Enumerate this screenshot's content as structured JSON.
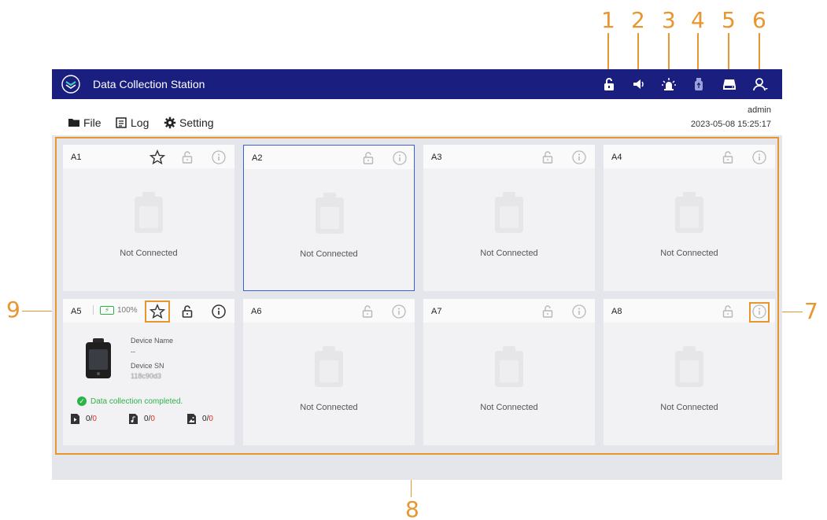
{
  "callouts": [
    "1",
    "2",
    "3",
    "4",
    "5",
    "6",
    "7",
    "8",
    "9"
  ],
  "app": {
    "title": "Data Collection Station",
    "user": "admin",
    "datetime": "2023-05-08 15:25:17"
  },
  "titlebar_icons": [
    "unlock-icon",
    "speaker-icon",
    "alarm-light-icon",
    "usb-drive-icon",
    "hard-disk-icon",
    "user-icon"
  ],
  "menu": {
    "file": "File",
    "log": "Log",
    "setting": "Setting"
  },
  "slots": [
    {
      "id": "A1",
      "status": "Not Connected"
    },
    {
      "id": "A2",
      "status": "Not Connected"
    },
    {
      "id": "A3",
      "status": "Not Connected"
    },
    {
      "id": "A4",
      "status": "Not Connected"
    },
    {
      "id": "A5",
      "battery": "100%",
      "device_name_label": "Device Name",
      "device_name": "--",
      "device_sn_label": "Device SN",
      "device_sn": "118c90d3",
      "collection_status": "Data collection completed.",
      "counters": [
        {
          "icon": "video-file-icon",
          "done": "0",
          "total": "0"
        },
        {
          "icon": "audio-file-icon",
          "done": "0",
          "total": "0"
        },
        {
          "icon": "image-file-icon",
          "done": "0",
          "total": "0"
        }
      ]
    },
    {
      "id": "A6",
      "status": "Not Connected"
    },
    {
      "id": "A7",
      "status": "Not Connected"
    },
    {
      "id": "A8",
      "status": "Not Connected"
    }
  ],
  "colors": {
    "titlebar": "#1a1e7e",
    "callout": "#e8962e",
    "success": "#2db24a",
    "error": "#e0302a",
    "selected_border": "#3a62d8"
  }
}
